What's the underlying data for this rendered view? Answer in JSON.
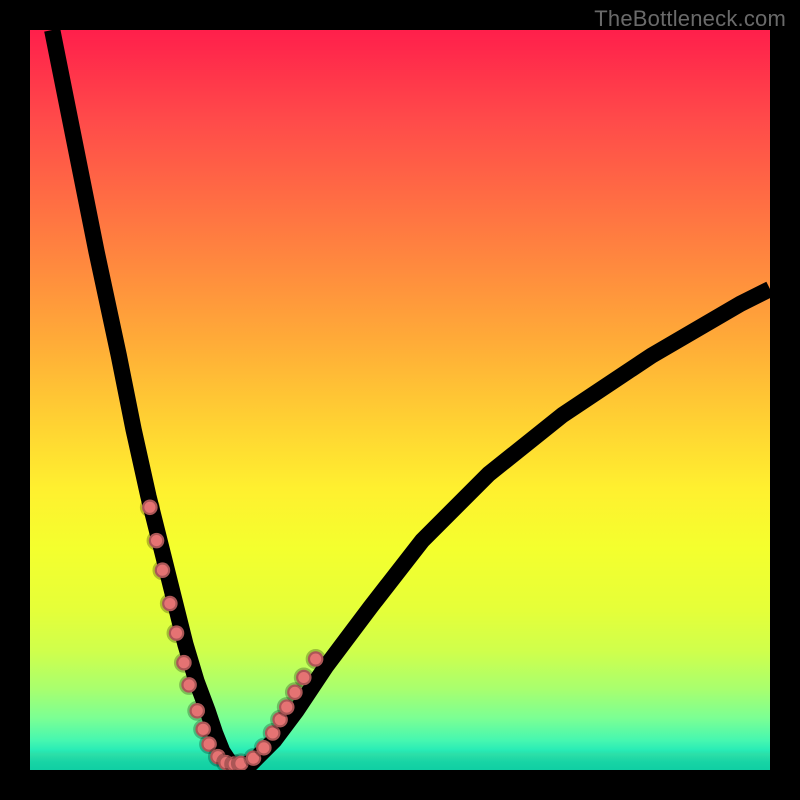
{
  "watermark": {
    "text": "TheBottleneck.com"
  },
  "chart_data": {
    "type": "line",
    "title": "",
    "xlabel": "",
    "ylabel": "",
    "xlim": [
      0,
      100
    ],
    "ylim": [
      0,
      100
    ],
    "grid": false,
    "legend": false,
    "series": [
      {
        "name": "bottleneck-curve",
        "x": [
          3,
          6,
          9,
          12,
          14,
          16,
          18,
          19.5,
          21,
          22.5,
          24,
          25,
          26,
          27,
          28,
          30,
          33,
          36,
          40,
          46,
          53,
          62,
          72,
          84,
          96,
          100
        ],
        "values": [
          100,
          85,
          70,
          56,
          46,
          37,
          29,
          23,
          17,
          12,
          8,
          5,
          2.5,
          1,
          0.5,
          1,
          4,
          8,
          14,
          22,
          31,
          40,
          48,
          56,
          63,
          65
        ]
      }
    ],
    "points": {
      "name": "highlighted-points",
      "x": [
        16.2,
        17.1,
        17.9,
        18.9,
        19.8,
        20.8,
        21.5,
        22.6,
        23.4,
        24.2,
        25.4,
        26.5,
        27.6,
        28.5,
        30.2,
        31.6,
        32.8,
        33.8,
        34.7,
        35.8,
        37.0,
        38.6
      ],
      "values": [
        35.5,
        31.0,
        27.0,
        22.5,
        18.5,
        14.5,
        11.5,
        8.0,
        5.5,
        3.5,
        1.8,
        1.0,
        0.8,
        0.9,
        1.6,
        3.0,
        5.0,
        6.8,
        8.5,
        10.5,
        12.5,
        15.0
      ]
    },
    "background_gradient": {
      "top": "#ff1f4b",
      "mid": "#ffe22f",
      "bottom": "#14d8b6"
    }
  }
}
